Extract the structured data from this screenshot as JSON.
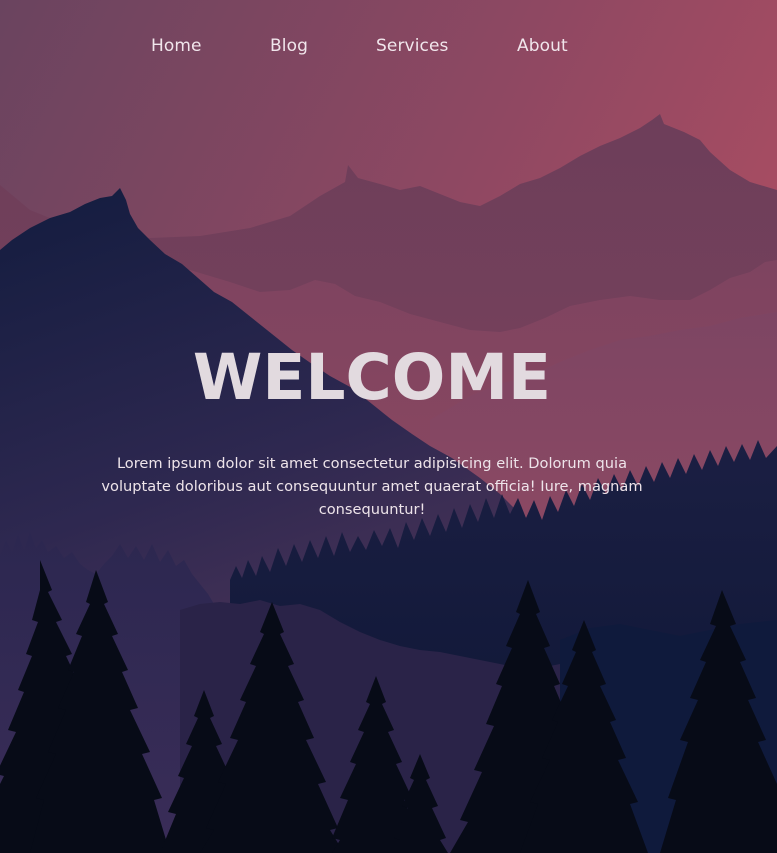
{
  "nav": {
    "items": [
      {
        "label": "Home"
      },
      {
        "label": "Blog"
      },
      {
        "label": "Services"
      },
      {
        "label": "About"
      }
    ]
  },
  "hero": {
    "title": "WELCOME",
    "text": "Lorem ipsum dolor sit amet consectetur adipisicing elit. Dolorum quia voluptate doloribus aut consequuntur amet quaerat officia! Iure, magnam consequuntur!"
  },
  "colors": {
    "sky_top_left": "#69445e",
    "sky_top_right": "#ab4d62",
    "mountain_dark": "#18203f",
    "forest_darkest": "#060a15",
    "text_light": "#f1e6ec"
  }
}
